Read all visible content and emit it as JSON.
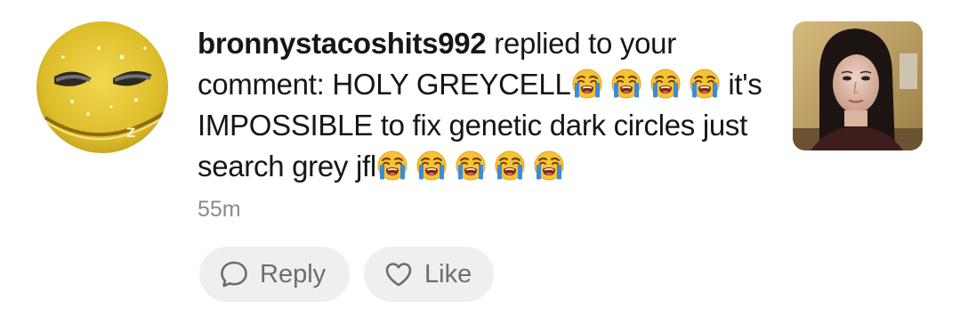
{
  "notification": {
    "username": "bronnystacoshits992",
    "action_text": " replied to your comment: ",
    "comment_part1": "HOLY GREYCELL",
    "comment_part2": "it's IMPOSSIBLE to fix genetic dark circles just search grey jfl",
    "emoji_name": "loudly-crying-face",
    "timestamp": "55m",
    "reply_label": "Reply",
    "like_label": "Like"
  },
  "colors": {
    "button_bg": "#efefef",
    "button_text": "#6d6d6d",
    "timestamp_text": "#8a8a8a",
    "avatar_yellow": "#e3c63a",
    "emoji_face": "#f7c332",
    "emoji_tears": "#3a8be0"
  }
}
